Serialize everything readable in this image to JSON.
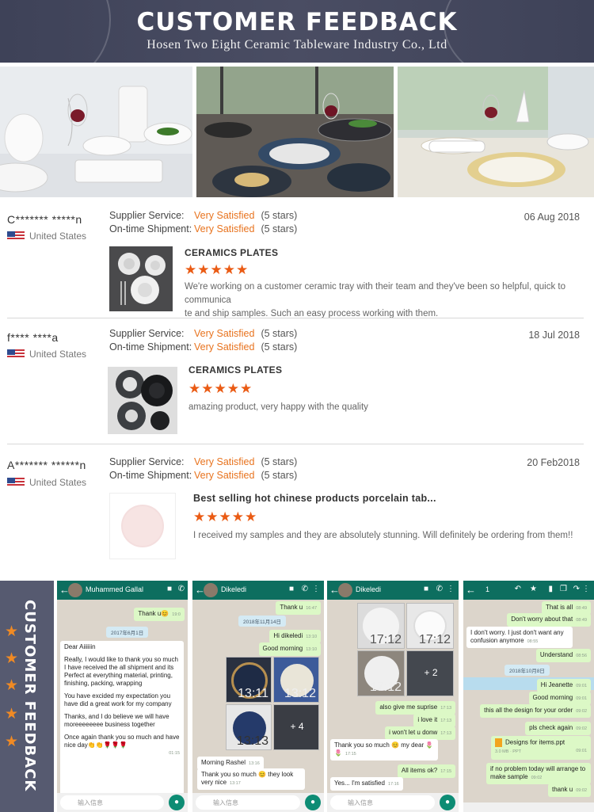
{
  "banner": {
    "title": "CUSTOMER FEEDBACK",
    "subtitle": "Hosen Two Eight Ceramic Tableware Industry Co., Ltd"
  },
  "colors": {
    "accent": "#e8731e",
    "star": "#ea5b14",
    "banner": "#45485e",
    "whatsapp": "#0d6e5f"
  },
  "reviews": [
    {
      "name": "C******* *****n",
      "country": "United States",
      "supplier_label": "Supplier Service:",
      "supplier_value": "Very Satisfied",
      "supplier_stars": "(5 stars)",
      "shipment_label": "On-time Shipment:",
      "shipment_value": "Very Satisfied",
      "shipment_stars": "(5 stars)",
      "date": "06 Aug 2018",
      "product_title": "CERAMICS PLATES",
      "rating_stars": "★★★★★",
      "comment_line1": "We're working on a customer ceramic tray with their team and they've been so helpful, quick to communica",
      "comment_line2": "te and ship samples. Such an easy process working with them."
    },
    {
      "name": "f**** ****a",
      "country": "United States",
      "supplier_label": "Supplier Service:",
      "supplier_value": "Very Satisfied",
      "supplier_stars": "(5 stars)",
      "shipment_label": "On-time Shipment:",
      "shipment_value": "Very Satisfied",
      "shipment_stars": "(5 stars)",
      "date": "18 Jul 2018",
      "product_title": "CERAMICS PLATES",
      "rating_stars": "★★★★★",
      "comment_line1": "amazing product, very happy with the quality",
      "comment_line2": ""
    },
    {
      "name": "A******* ******n",
      "country": "United States",
      "supplier_label": "Supplier Service:",
      "supplier_value": "Very Satisfied",
      "supplier_stars": "(5 stars)",
      "shipment_label": "On-time Shipment:",
      "shipment_value": "Very Satisfied",
      "shipment_stars": "(5 stars)",
      "date": "20 Feb2018",
      "product_title": "Best selling hot chinese products porcelain tab...",
      "rating_stars": "★★★★★",
      "comment_line1": "I received my samples and they are absolutely stunning.  Will definitely be ordering from them!!",
      "comment_line2": ""
    }
  ],
  "side_label": "CUSTOMER FEEDBACK",
  "chats": [
    {
      "contact": "Muhammed Gallal",
      "input_placeholder": "输入信息",
      "messages": {
        "m1": "Thank u😊",
        "m1_time": "19:0",
        "date": "2017年6月1日",
        "greeting": "Dear Aiiiiiin",
        "p1": "Really, I would like to thank you so much I have received the all shipment and its",
        "p2": "Perfect at everything material, printing, finishing, packing, wrapping",
        "p3": "You have excided my expectation you have did a great work for my company",
        "p4": "Thanks, and I do believe we will have moreeeeeeee business together",
        "p5": "Once again thank you so much and have nice day👏👏🌹🌹🌹",
        "p5_time": "01:15"
      }
    },
    {
      "contact": "Dikeledi",
      "input_placeholder": "输入信息",
      "messages": {
        "m1": "Thank u",
        "m1_time": "16:47",
        "date": "2018年11月14日",
        "m2": "Hi dikeledi",
        "m2_time": "13:10",
        "m3": "Good morning",
        "m3_time": "13:10",
        "img_time1": "13:11",
        "img_time2": "13:12",
        "img_time3": "13:13",
        "more": "+ 4",
        "m4": "Morning Rashel",
        "m4_time": "13:16",
        "m5": "Thank you so much 😊 they look very nice",
        "m5_time": "13:17"
      }
    },
    {
      "contact": "Dikeledi",
      "input_placeholder": "输入信息",
      "messages": {
        "img_time1": "17:12",
        "img_time2": "17:12",
        "img_time3": "17:12",
        "more": "+ 2",
        "m1": "also give me suprise",
        "m1_time": "17:13",
        "m2": "i love it",
        "m2_time": "17:13",
        "m3": "i won't let u donw",
        "m3_time": "17:13",
        "m4": "Thank you so much 😊 my dear 🌷🌷",
        "m4_time": "17:15",
        "m5": "All items ok?",
        "m5_time": "17:15",
        "m6": "Yes... I'm satisfied",
        "m6_time": "17:16"
      }
    },
    {
      "page_no": "1",
      "messages": {
        "m1": "That is all",
        "m1_time": "08:49",
        "m2": "Don't worry about that",
        "m2_time": "08:49",
        "m3": "I don't worry. I just don't want any confusion anymore",
        "m3_time": "08:55",
        "m4": "Understand",
        "m4_time": "08:56",
        "date": "2018年10月8日",
        "m5": "Hi Jeanette",
        "m5_time": "09:01",
        "m6": "Good morning",
        "m6_time": "09:01",
        "m7": "this all the design for your order",
        "m7_time": "09:02",
        "m8": "pls check again",
        "m8_time": "09:02",
        "file": "Designs for items.ppt",
        "file_meta": "3.0 MB · PPT",
        "file_time": "09:01",
        "m9": "if no problem today will arrange to make sample",
        "m9_time": "09:02",
        "m10": "thank u",
        "m10_time": "09:02"
      }
    }
  ]
}
